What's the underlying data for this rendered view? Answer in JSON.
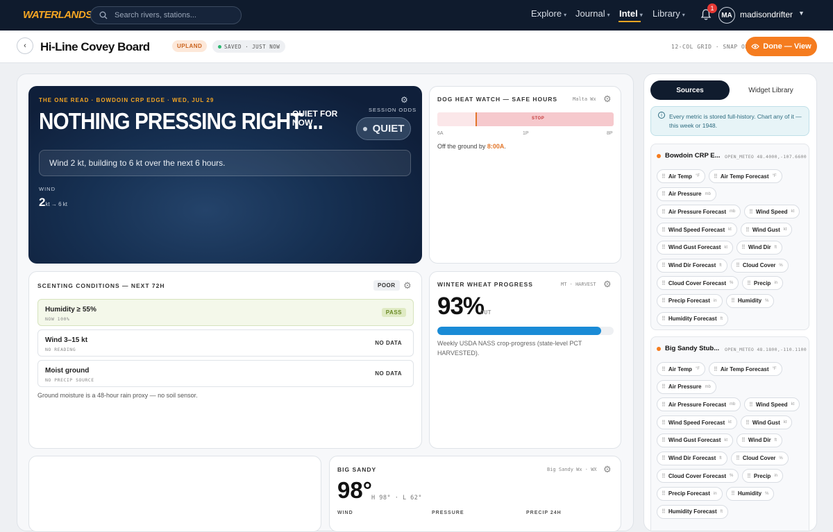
{
  "nav": {
    "logo": "WATERLANDS",
    "search_placeholder": "Search rivers, stations...",
    "links": [
      "Explore",
      "Journal",
      "Intel",
      "Library"
    ],
    "active": "Intel",
    "notifications": "1",
    "avatar_initials": "MA",
    "username": "madisondrifter"
  },
  "toolbar": {
    "title": "Hi-Line Covey Board",
    "tag": "UPLAND",
    "saved": "SAVED · JUST NOW",
    "grid_meta": "12-COL GRID · SNAP ON",
    "done_label": "Done — View"
  },
  "hero": {
    "kicker": "THE ONE READ · BOWDOIN CRP EDGE · WED, JUL 29",
    "headline": "NOTHING PRESSING RIGHT ...",
    "quiet_for": "QUIET FOR NOW",
    "odds_label": "SESSION ODDS",
    "odds_value": "QUIET",
    "summary": "Wind 2 kt, building to 6 kt over the next 6 hours.",
    "wind_label": "WIND",
    "wind_value": "2",
    "wind_unit": "kt → 6 kt"
  },
  "heat": {
    "title": "DOG HEAT WATCH — SAFE HOURS",
    "source": "Malta Wx",
    "stop_label": "STOP",
    "ticks": [
      "6A",
      "1P",
      "8P"
    ],
    "note_prefix": "Off the ground by",
    "note_time": "8:00A",
    "note_suffix": "."
  },
  "scent": {
    "title": "SCENTING CONDITIONS — NEXT 72H",
    "rating": "POOR",
    "rows": [
      {
        "title": "Humidity ≥ 55%",
        "sub": "NOW 100%",
        "badge": "PASS"
      },
      {
        "title": "Wind 3–15 kt",
        "sub": "NO READING",
        "badge": "NO DATA"
      },
      {
        "title": "Moist ground",
        "sub": "NO PRECIP SOURCE",
        "badge": "NO DATA"
      }
    ],
    "note": "Ground moisture is a 48-hour rain proxy — no soil sensor."
  },
  "wheat": {
    "title": "WINTER WHEAT PROGRESS",
    "meta": "MT · HARVEST",
    "pct": "93%",
    "out": "OUT",
    "progress": 0.93,
    "note": "Weekly USDA NASS crop-progress (state-level PCT HARVESTED)."
  },
  "bigsandy": {
    "title": "BIG SANDY",
    "source": "Big Sandy Wx · WX",
    "temp": "98°",
    "hilo": "H 98° · L 62°",
    "subs": [
      "WIND",
      "PRESSURE",
      "PRECIP 24H"
    ]
  },
  "panel": {
    "tabs": [
      "Sources",
      "Widget Library"
    ],
    "info": "Every metric is stored full-history. Chart any of it — this week or 1948.",
    "sources": [
      {
        "name": "Bowdoin CRP E...",
        "meta": "OPEN_METEO 48.4000,-107.6600",
        "chips": [
          {
            "label": "Air Temp",
            "unit": "°F"
          },
          {
            "label": "Air Temp Forecast",
            "unit": "°F"
          },
          {
            "label": "Air Pressure",
            "unit": "mb"
          },
          {
            "label": "Air Pressure Forecast",
            "unit": "mb"
          },
          {
            "label": "Wind Speed",
            "unit": "kt"
          },
          {
            "label": "Wind Speed Forecast",
            "unit": "kt"
          },
          {
            "label": "Wind Gust",
            "unit": "kt"
          },
          {
            "label": "Wind Gust Forecast",
            "unit": "kt"
          },
          {
            "label": "Wind Dir",
            "unit": "ft"
          },
          {
            "label": "Wind Dir Forecast",
            "unit": "ft"
          },
          {
            "label": "Cloud Cover",
            "unit": "%"
          },
          {
            "label": "Cloud Cover Forecast",
            "unit": "%"
          },
          {
            "label": "Precip",
            "unit": "in"
          },
          {
            "label": "Precip Forecast",
            "unit": "in"
          },
          {
            "label": "Humidity",
            "unit": "%"
          },
          {
            "label": "Humidity Forecast",
            "unit": "ft"
          }
        ]
      },
      {
        "name": "Big Sandy Stub...",
        "meta": "OPEN_METEO 48.1800,-110.1100",
        "chips": [
          {
            "label": "Air Temp",
            "unit": "°F"
          },
          {
            "label": "Air Temp Forecast",
            "unit": "°F"
          },
          {
            "label": "Air Pressure",
            "unit": "mb"
          },
          {
            "label": "Air Pressure Forecast",
            "unit": "mb"
          },
          {
            "label": "Wind Speed",
            "unit": "kt"
          },
          {
            "label": "Wind Speed Forecast",
            "unit": "kt"
          },
          {
            "label": "Wind Gust",
            "unit": "kt"
          },
          {
            "label": "Wind Gust Forecast",
            "unit": "kt"
          },
          {
            "label": "Wind Dir",
            "unit": "ft"
          },
          {
            "label": "Wind Dir Forecast",
            "unit": "ft"
          },
          {
            "label": "Cloud Cover",
            "unit": "%"
          },
          {
            "label": "Cloud Cover Forecast",
            "unit": "%"
          },
          {
            "label": "Precip",
            "unit": "in"
          },
          {
            "label": "Precip Forecast",
            "unit": "in"
          },
          {
            "label": "Humidity",
            "unit": "%"
          },
          {
            "label": "Humidity Forecast",
            "unit": "ft"
          }
        ]
      }
    ]
  }
}
